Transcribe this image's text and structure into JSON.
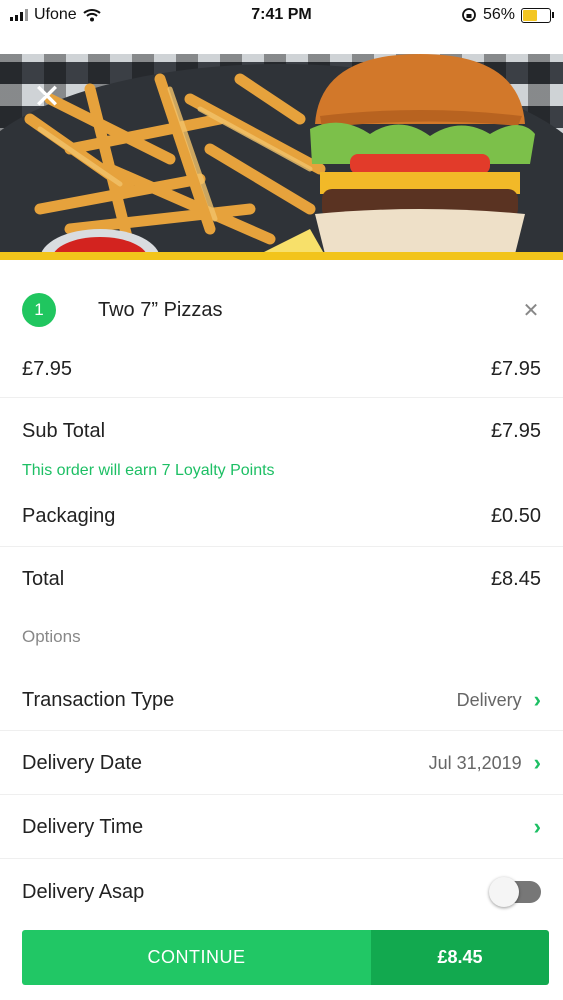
{
  "status_bar": {
    "carrier": "Ufone",
    "time": "7:41 PM",
    "battery_percent": "56%",
    "battery_level": 0.56
  },
  "hero": {
    "close_icon": "close-icon"
  },
  "item": {
    "number": "1",
    "name": "Two 7” Pizzas",
    "unit_price": "£7.95",
    "line_price": "£7.95"
  },
  "summary": {
    "subtotal_label": "Sub Total",
    "subtotal_value": "£7.95",
    "loyalty_note": "This order will earn 7 Loyalty Points",
    "packaging_label": "Packaging",
    "packaging_value": "£0.50",
    "total_label": "Total",
    "total_value": "£8.45"
  },
  "options": {
    "section_title": "Options",
    "transaction_type_label": "Transaction Type",
    "transaction_type_value": "Delivery",
    "delivery_date_label": "Delivery Date",
    "delivery_date_value": "Jul 31,2019",
    "delivery_time_label": "Delivery Time",
    "delivery_asap_label": "Delivery Asap",
    "delivery_asap_on": false
  },
  "footer": {
    "continue_label": "CONTINUE",
    "total_label": "£8.45"
  },
  "colors": {
    "accent_green": "#21c765",
    "dark_green": "#12a94f",
    "yellow": "#f2c41b"
  }
}
